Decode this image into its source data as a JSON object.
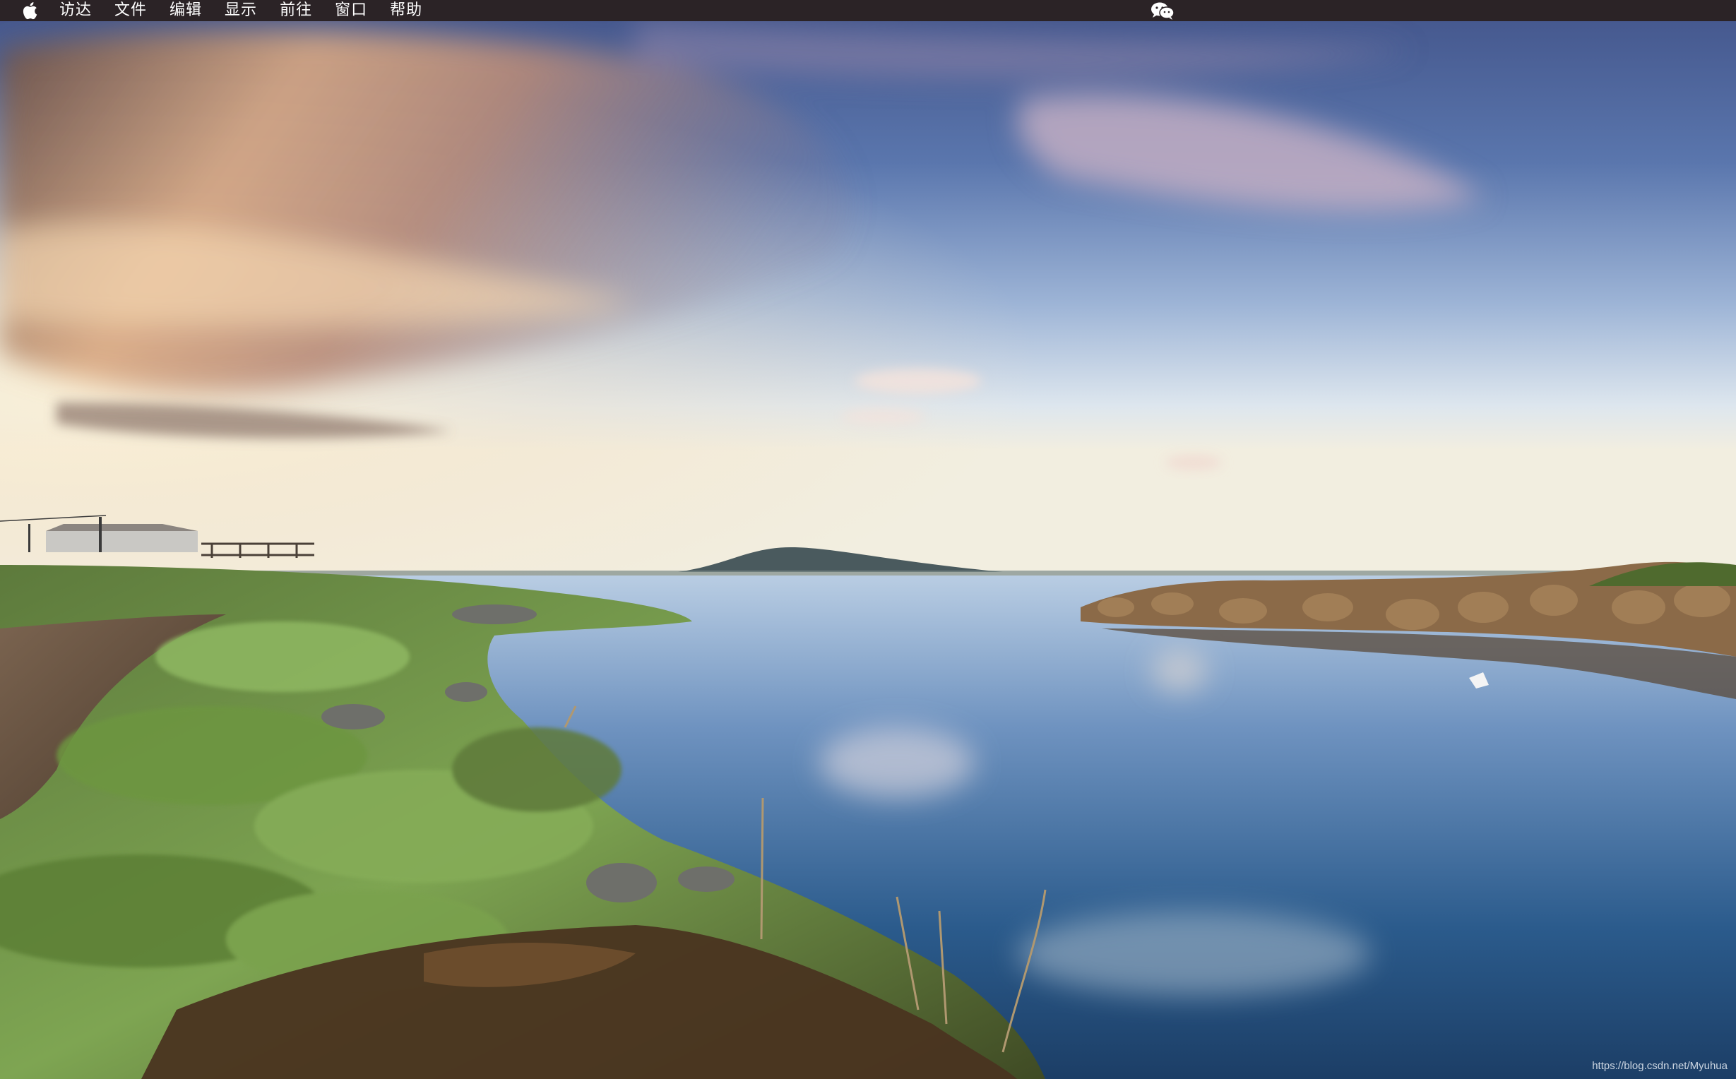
{
  "menubar": {
    "apple_icon": "apple-logo-icon",
    "items": [
      "访达",
      "文件",
      "编辑",
      "显示",
      "前往",
      "窗口",
      "帮助"
    ],
    "status_icons": [
      "wechat-icon"
    ],
    "background": "#2b2326"
  },
  "desktop": {
    "wallpaper": "coastal-lagoon-sunset",
    "watermark": "https://blog.csdn.net/Myuhua"
  }
}
